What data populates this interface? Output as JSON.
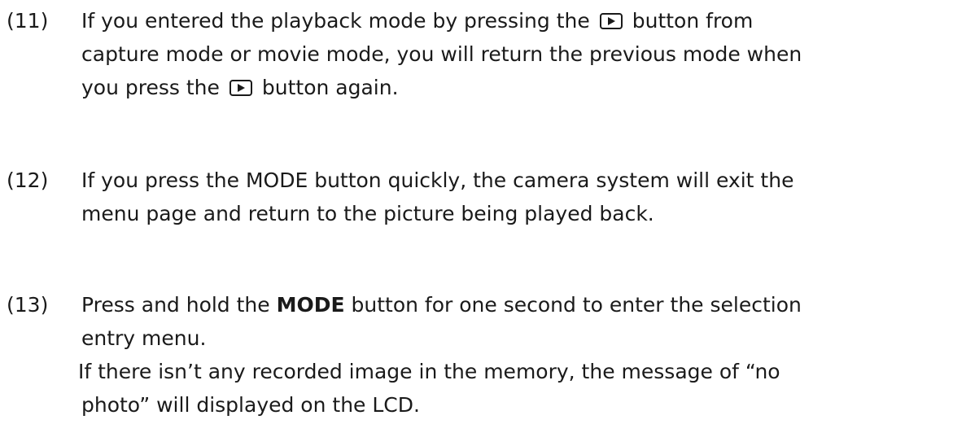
{
  "items": [
    {
      "number": "(11)",
      "line1_a": "If you entered the playback mode by pressing the",
      "line1_b": "button from",
      "line2": "capture mode or movie mode, you will return the previous mode when",
      "line3_a": "you press the",
      "line3_b": "button again.",
      "icon": "playback-button-icon"
    },
    {
      "number": "(12)",
      "line1": "If you press the MODE button quickly, the camera system will exit the",
      "line2": "menu page and return to the picture being played back."
    },
    {
      "number": "(13)",
      "line1_a": "Press and hold the",
      "line1_bold": "MODE",
      "line1_b": "button for one second to enter the selection",
      "line2": "entry menu.",
      "note_line1": "If there isn’t any recorded image in the memory, the message of “no",
      "note_line2": "photo” will displayed on the LCD."
    }
  ]
}
